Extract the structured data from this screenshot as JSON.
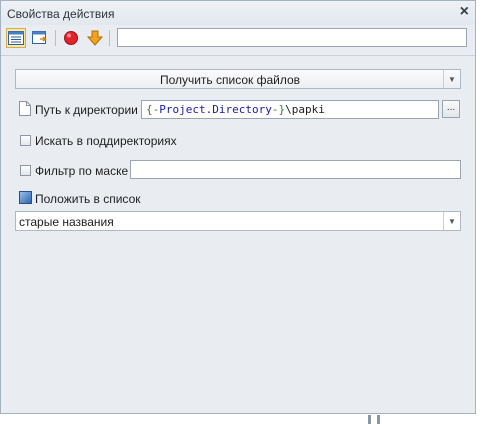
{
  "window": {
    "title": "Свойства действия",
    "close_glyph": "×"
  },
  "toolbar": {
    "icons": [
      "properties-view-icon",
      "export-icon",
      "breakpoint-icon",
      "down-arrow-icon"
    ],
    "search_value": ""
  },
  "action_select": {
    "value": "Получить список файлов",
    "arrow": "▼"
  },
  "directory": {
    "label": "Путь к директории",
    "value_open": "{-",
    "value_var": "Project.Directory",
    "value_close": "-}",
    "value_suffix": "\\papki",
    "browse": "..."
  },
  "subdirs": {
    "label": "Искать в поддиректориях",
    "checked": false
  },
  "mask_filter": {
    "label": "Фильтр по маске",
    "checked": false,
    "value": ""
  },
  "put_in_list": {
    "label": "Положить в список",
    "checked": true
  },
  "list_select": {
    "value": "старые названия",
    "arrow": "▼"
  },
  "colors": {
    "brace": "#2f7f2f",
    "variable": "#1a1aa6",
    "path": "#1e1e1e",
    "accent": "#3b6fb5"
  }
}
